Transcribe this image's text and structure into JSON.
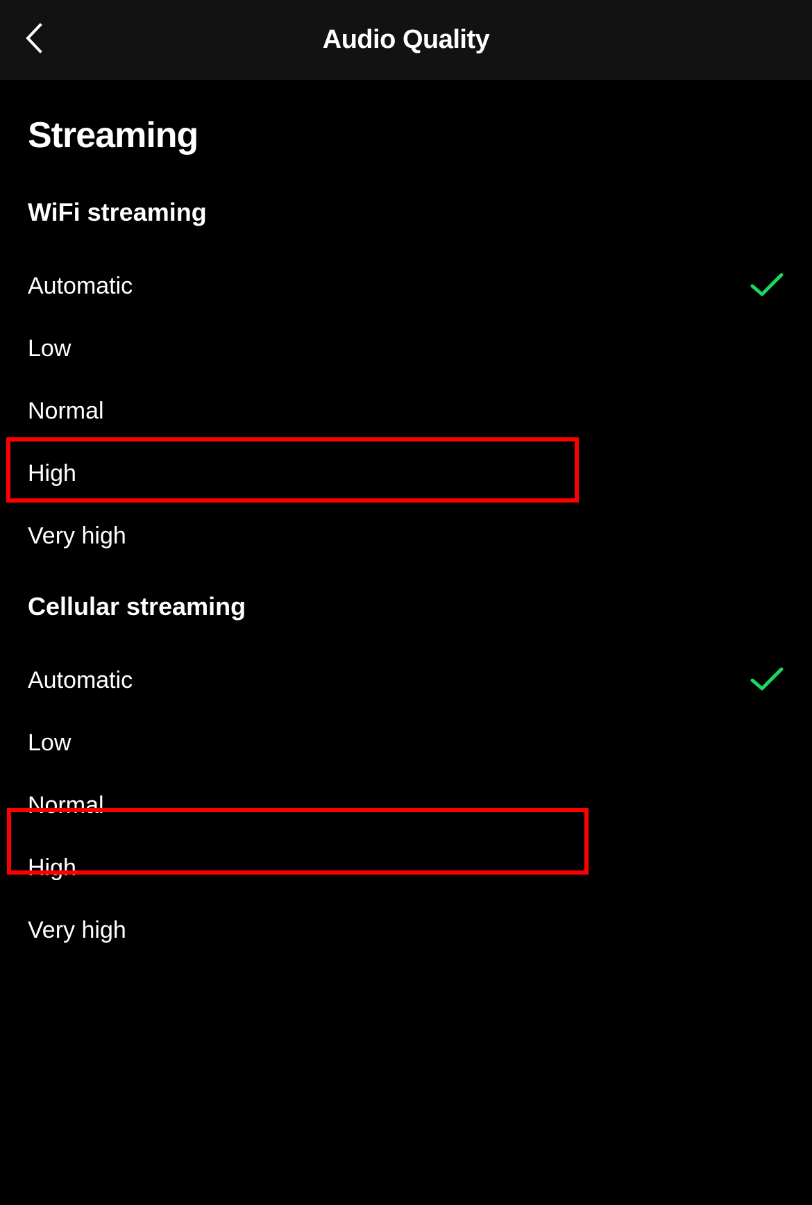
{
  "header": {
    "title": "Audio Quality"
  },
  "section": {
    "title": "Streaming"
  },
  "group1": {
    "title": "WiFi streaming",
    "options": [
      {
        "label": "Automatic",
        "selected": true
      },
      {
        "label": "Low",
        "selected": false
      },
      {
        "label": "Normal",
        "selected": false
      },
      {
        "label": "High",
        "selected": false
      },
      {
        "label": "Very high",
        "selected": false
      }
    ]
  },
  "group2": {
    "title": "Cellular streaming",
    "options": [
      {
        "label": "Automatic",
        "selected": true
      },
      {
        "label": "Low",
        "selected": false
      },
      {
        "label": "Normal",
        "selected": false
      },
      {
        "label": "High",
        "selected": false
      },
      {
        "label": "Very high",
        "selected": false
      }
    ]
  },
  "colors": {
    "accent": "#1ED760",
    "highlight": "#ff0000"
  }
}
